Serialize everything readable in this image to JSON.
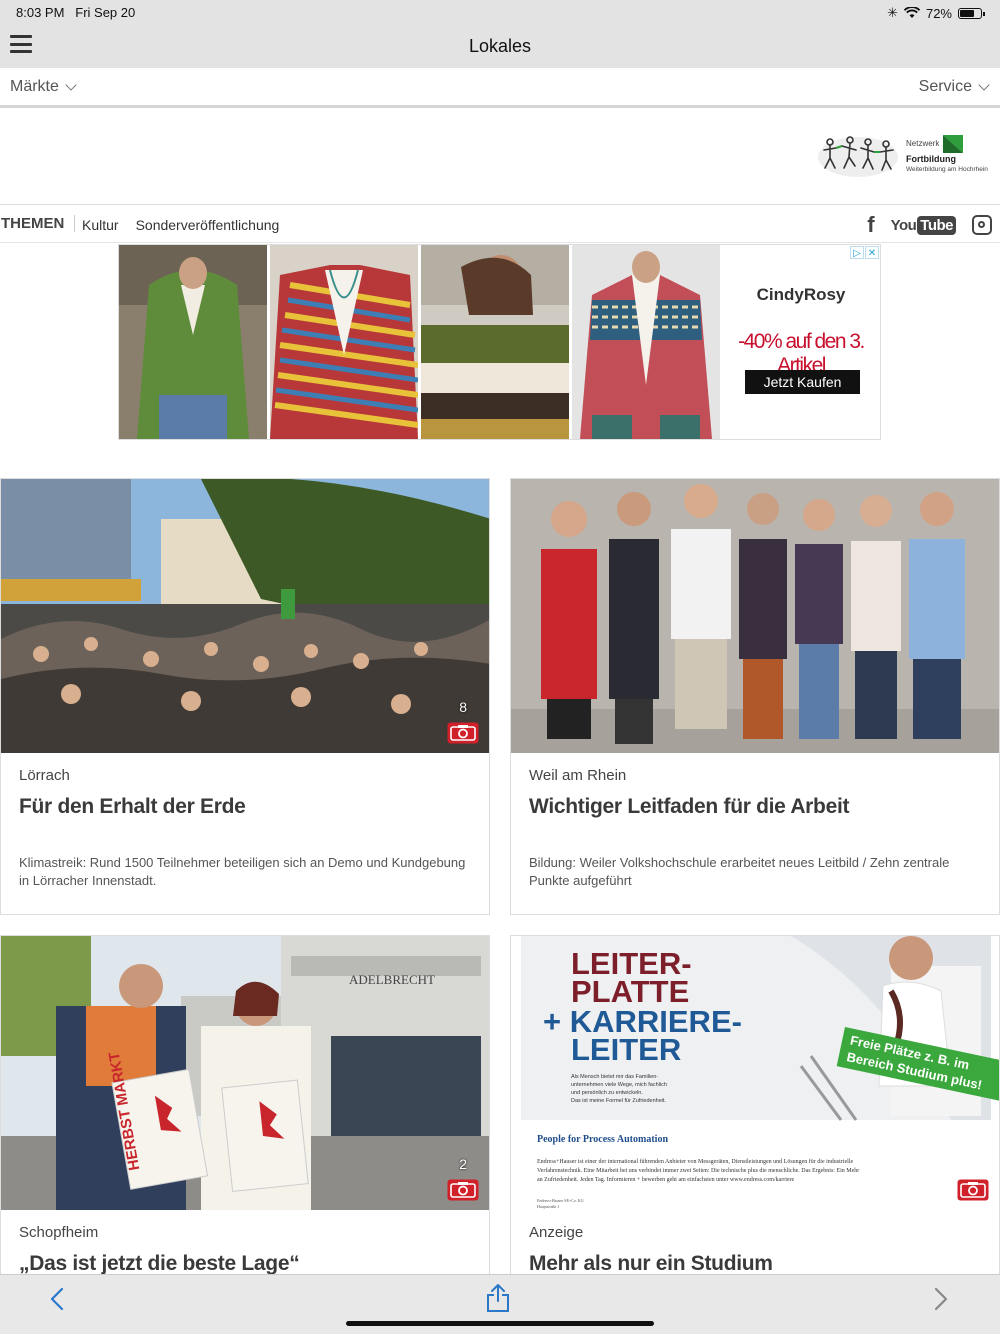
{
  "status": {
    "time": "8:03 PM",
    "date": "Fri Sep 20",
    "battery": "72%",
    "battery_level": 0.72
  },
  "navbar": {
    "title": "Lokales",
    "menu_icon": "hamburger-icon"
  },
  "subnav": {
    "left_label": "Märkte",
    "right_label": "Service"
  },
  "logo": {
    "line1": "Netzwerk",
    "line2": "Fortbildung",
    "line3": "Weiterbildung am Hochrhein"
  },
  "themen": {
    "heading": "THEMEN",
    "links": [
      "Kultur",
      "Sonderveröffentlichung"
    ],
    "social": {
      "facebook": "f",
      "youtube_you": "You",
      "youtube_tube": "Tube"
    }
  },
  "ad": {
    "brand": "CindyRosy",
    "promo": "-40% auf den 3. Artikel",
    "cta": "Jetzt Kaufen"
  },
  "cards": [
    {
      "place": "Lörrach",
      "headline": "Für den Erhalt der Erde",
      "teaser": "Klimastreik: Rund 1500 Teilnehmer beteiligen sich an Demo und Kundgebung in Lörracher Innenstadt.",
      "photo_count": "8"
    },
    {
      "place": "Weil am Rhein",
      "headline": "Wichtiger Leitfaden für die Arbeit",
      "teaser": "Bildung: Weiler Volkshochschule erarbeitet neues Leitbild / Zehn zentrale Punkte aufgeführt"
    },
    {
      "place": "Schopfheim",
      "headline": "„Das ist jetzt die beste Lage“",
      "photo_count": "2",
      "poster_text": "HERBST MARKT",
      "store_sign": "ADELBRECHT"
    },
    {
      "place": "Anzeige",
      "headline": "Mehr als nur ein Studium",
      "ad_title_1": "LEITER-",
      "ad_title_2": "PLATTE",
      "ad_title_3": "+ KARRIERE-",
      "ad_title_4": "LEITER",
      "ad_small_1": "Als Mensch bietet mir das Familien-",
      "ad_small_2": "unternehmen viele Wege, mich fachlich",
      "ad_small_3": "und persönlich zu entwickeln.",
      "ad_small_4": "Das ist meine Formel für Zufriedenheit.",
      "badge_1": "Freie Plätze z. B. im",
      "badge_2": "Bereich Studium plus!",
      "ad_company": "People for Process Automation",
      "ad_body_1": "Endress+Hauser ist einer der international führenden Anbieter von Messgeräten, Dienstleistungen und Lösungen für die industrielle",
      "ad_body_2": "Verfahrenstechnik. Eine Mitarbeit bei uns verbindet immer zwei Seiten: Die technische plus die menschliche. Das Ergebnis: Ein Mehr",
      "ad_body_3": "an Zufriedenheit. Jeden Tag. Informieren + bewerben geht am einfachsten unter www.endress.com/karriere",
      "ad_footer_1": "Endress+Hauser SE+Co. KG",
      "ad_footer_2": "Hauptstraße 1"
    }
  ]
}
